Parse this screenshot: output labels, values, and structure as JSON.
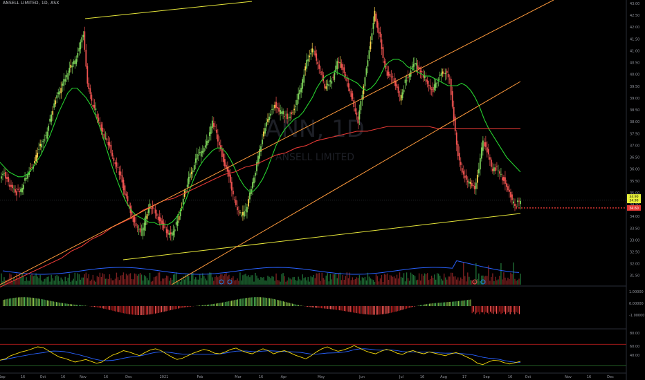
{
  "header": {
    "title": "ANSELL LIMITED, 1D, ASX"
  },
  "watermark": {
    "symbol": "ANN, 1D",
    "name": "ANSELL LIMITED"
  },
  "colors": {
    "background": "#000000",
    "up": "#26a69a",
    "up_body": "#7dd35a",
    "down": "#ef5350",
    "ma_fast": "#27d12f",
    "ma_slow": "#e53935",
    "trendline_yellow": "#e6e63a",
    "trendline_orange": "#ff9a3c",
    "volume_ma": "#2962ff",
    "rsi_line": "#f5d90a",
    "rsi_ma": "#2962ff",
    "price_label_last": "#e8f03a",
    "price_label_level": "#e53935"
  },
  "price_axis": {
    "ticks": [
      "43.00",
      "42.50",
      "42.00",
      "41.50",
      "41.00",
      "40.50",
      "40.00",
      "39.50",
      "39.00",
      "38.50",
      "38.00",
      "37.50",
      "37.00",
      "36.50",
      "36.00",
      "35.50",
      "35.00",
      "34.50",
      "34.00",
      "33.50",
      "33.00",
      "32.50",
      "32.00",
      "31.50"
    ]
  },
  "last_price_label": [
    "34.90",
    "34.90"
  ],
  "level_label": "34.60",
  "macd_axis": {
    "ticks": [
      "1.00000",
      "0.00000",
      "-1.00000"
    ]
  },
  "rsi_axis": {
    "ticks": [
      "80.00",
      "60.00",
      "40.00"
    ]
  },
  "time_axis": {
    "ticks": [
      "Sep",
      "16",
      "Oct",
      "16",
      "Nov",
      "16",
      "Dec",
      "2021",
      "Feb",
      "Mar",
      "16",
      "Apr",
      "May",
      "Jun",
      "Jul",
      "16",
      "Aug",
      "17",
      "Sep",
      "16",
      "Oct",
      "Nov",
      "16",
      "Dec"
    ]
  },
  "chart_data": {
    "type": "candlestick",
    "symbol": "ANN",
    "timeframe": "1D",
    "exchange": "ASX",
    "y_range": [
      31.4,
      43.1
    ],
    "series": [
      {
        "name": "close",
        "values": [
          36.1,
          35.7,
          35.5,
          35.2,
          35.3,
          35.9,
          36.2,
          36.4,
          36.9,
          37.3,
          37.6,
          38.4,
          38.9,
          39.4,
          39.8,
          40.2,
          40.5,
          40.8,
          41.3,
          41.9,
          39.7,
          39.1,
          38.7,
          38.1,
          37.6,
          37.2,
          36.8,
          36.4,
          35.9,
          35.2,
          34.6,
          34.1,
          33.8,
          33.6,
          34.2,
          34.8,
          34.6,
          34.2,
          33.9,
          33.6,
          33.5,
          33.8,
          34.2,
          34.9,
          35.6,
          36.2,
          36.6,
          36.9,
          37.1,
          37.5,
          38.2,
          37.8,
          37.0,
          36.4,
          35.9,
          35.1,
          34.6,
          34.3,
          34.6,
          35.2,
          35.9,
          36.7,
          37.5,
          38.2,
          38.6,
          38.9,
          38.7,
          38.6,
          38.4,
          38.6,
          38.9,
          39.5,
          40.2,
          40.9,
          41.2,
          40.8,
          40.2,
          39.6,
          39.7,
          40.1,
          40.7,
          40.5,
          40.1,
          39.4,
          38.9,
          38.2,
          39.4,
          40.4,
          41.6,
          42.8,
          41.9,
          40.9,
          40.2,
          40.0,
          39.7,
          39.2,
          39.6,
          40.1,
          40.5,
          40.7,
          40.3,
          40.0,
          39.6,
          39.5,
          39.9,
          40.2,
          40.3,
          39.9,
          38.3,
          36.8,
          36.1,
          35.8,
          35.6,
          35.3,
          36.3,
          37.5,
          37.0,
          36.3,
          36.2,
          36.1,
          35.7,
          35.4,
          34.9,
          34.7,
          34.9
        ]
      },
      {
        "name": "ma_fast",
        "values": [
          36.5,
          36.3,
          36.1,
          36.0,
          35.9,
          35.9,
          36.0,
          36.2,
          36.5,
          36.8,
          37.2,
          37.6,
          38.1,
          38.6,
          39.0,
          39.4,
          39.6,
          39.6,
          39.4,
          39.2,
          38.9,
          38.5,
          38.0,
          37.4,
          36.8,
          36.2,
          35.7,
          35.2,
          34.8,
          34.5,
          34.3,
          34.2,
          34.1,
          34.0,
          34.0,
          33.9,
          33.9,
          33.9,
          34.0,
          34.2,
          34.5,
          34.9,
          35.4,
          35.9,
          36.3,
          36.6,
          36.8,
          37.0,
          37.1,
          37.1,
          36.9,
          36.6,
          36.2,
          35.8,
          35.5,
          35.3,
          35.3,
          35.5,
          35.8,
          36.2,
          36.7,
          37.2,
          37.6,
          37.9,
          38.1,
          38.3,
          38.4,
          38.6,
          38.9,
          39.2,
          39.6,
          39.9,
          40.1,
          40.2,
          40.3,
          40.2,
          40.1,
          40.0,
          39.9,
          39.8,
          39.6,
          39.5,
          39.6,
          39.8,
          40.1,
          40.5,
          40.7,
          40.8,
          40.8,
          40.7,
          40.5,
          40.4,
          40.3,
          40.2,
          40.1,
          40.1,
          40.0,
          39.9,
          39.8,
          39.7,
          39.7,
          39.7,
          39.8,
          39.7,
          39.5,
          39.2,
          38.8,
          38.3,
          37.9,
          37.6,
          37.3,
          37.0,
          36.7,
          36.5,
          36.3,
          36.1
        ]
      },
      {
        "name": "ma_slow",
        "values": [
          31.3,
          31.5,
          31.7,
          31.9,
          32.1,
          32.3,
          32.5,
          32.8,
          33.0,
          33.3,
          33.5,
          33.8,
          34.0,
          34.2,
          34.5,
          34.7,
          34.9,
          35.0,
          35.2,
          35.4,
          35.6,
          35.8,
          36.0,
          36.1,
          36.3,
          36.4,
          36.6,
          36.8,
          36.9,
          37.1,
          37.2,
          37.4,
          37.5,
          37.6,
          37.7,
          37.8,
          37.8,
          37.9,
          38.0,
          38.0,
          38.0,
          38.0,
          38.0,
          37.9,
          37.9,
          37.9,
          37.9,
          37.9,
          37.9,
          37.9,
          37.9,
          37.9
        ]
      },
      {
        "name": "rsi",
        "values": [
          45,
          47,
          52,
          55,
          58,
          60,
          63,
          66,
          65,
          60,
          55,
          50,
          48,
          45,
          42,
          44,
          46,
          43,
          40,
          42,
          48,
          53,
          56,
          60,
          58,
          55,
          52,
          57,
          61,
          63,
          60,
          55,
          50,
          46,
          48,
          52,
          56,
          59,
          62,
          60,
          56,
          55,
          58,
          62,
          64,
          60,
          57,
          55,
          59,
          63,
          60,
          55,
          58,
          60,
          57,
          53,
          50,
          47,
          52,
          58,
          63,
          66,
          62,
          59,
          61,
          64,
          68,
          64,
          60,
          57,
          55,
          59,
          62,
          60,
          56,
          54,
          58,
          60,
          57,
          55,
          58,
          56,
          54,
          52,
          55,
          57,
          54,
          50,
          46,
          40,
          38,
          42,
          45,
          44,
          41,
          39,
          41,
          43
        ]
      }
    ]
  }
}
